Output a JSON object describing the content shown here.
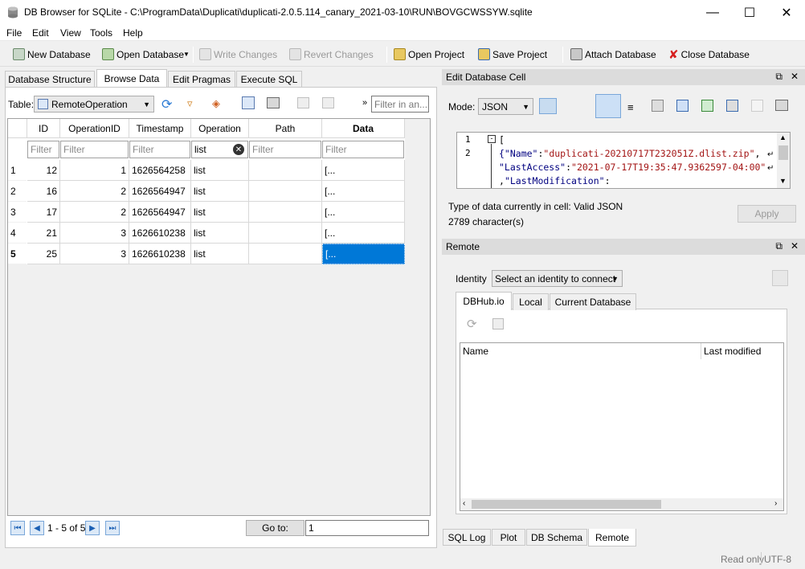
{
  "window": {
    "title": "DB Browser for SQLite - C:\\ProgramData\\Duplicati\\duplicati-2.0.5.114_canary_2021-03-10\\RUN\\BOVGCWSSYW.sqlite"
  },
  "menu": [
    "File",
    "Edit",
    "View",
    "Tools",
    "Help"
  ],
  "toolbar": {
    "new_db": "New Database",
    "open_db": "Open Database",
    "write": "Write Changes",
    "revert": "Revert Changes",
    "open_project": "Open Project",
    "save_project": "Save Project",
    "attach": "Attach Database",
    "close_db": "Close Database"
  },
  "tabs": [
    "Database Structure",
    "Browse Data",
    "Edit Pragmas",
    "Execute SQL"
  ],
  "browse": {
    "table_label": "Table:",
    "table_name": "RemoteOperation",
    "filter_any_placeholder": "Filter in an...",
    "columns": [
      "ID",
      "OperationID",
      "Timestamp",
      "Operation",
      "Path",
      "Data"
    ],
    "filter_placeholder": "Filter",
    "operation_filter": "list",
    "rows": [
      {
        "n": "1",
        "id": "12",
        "opid": "1",
        "ts": "1626564258",
        "op": "list",
        "path": "",
        "data": "[..."
      },
      {
        "n": "2",
        "id": "16",
        "opid": "2",
        "ts": "1626564947",
        "op": "list",
        "path": "",
        "data": "[..."
      },
      {
        "n": "3",
        "id": "17",
        "opid": "2",
        "ts": "1626564947",
        "op": "list",
        "path": "",
        "data": "[..."
      },
      {
        "n": "4",
        "id": "21",
        "opid": "3",
        "ts": "1626610238",
        "op": "list",
        "path": "",
        "data": "[..."
      },
      {
        "n": "5",
        "id": "25",
        "opid": "3",
        "ts": "1626610238",
        "op": "list",
        "path": "",
        "data": "[..."
      }
    ],
    "pager": "1 - 5 of 5",
    "goto_label": "Go to:",
    "goto_value": "1"
  },
  "edit_cell": {
    "title": "Edit Database Cell",
    "mode_label": "Mode:",
    "mode": "JSON",
    "line1": "[",
    "line2_key1": "{\"Name\"",
    "line2_val1": "\"duplicati-20210717T232051Z.dlist.zip\"",
    "line2_key2": "\"LastAccess\"",
    "line2_val2": "\"2021-07-17T19:35:47.9362597-04:00\"",
    "line2_key3": "\"LastModification\"",
    "type_info": "Type of data currently in cell: Valid JSON",
    "chars": "2789 character(s)",
    "apply": "Apply"
  },
  "remote": {
    "title": "Remote",
    "identity_label": "Identity",
    "identity_value": "Select an identity to connect",
    "tabs": [
      "DBHub.io",
      "Local",
      "Current Database"
    ],
    "col_name": "Name",
    "col_modified": "Last modified"
  },
  "bottom_tabs": [
    "SQL Log",
    "Plot",
    "DB Schema",
    "Remote"
  ],
  "status": {
    "readonly": "Read only",
    "encoding": "UTF-8"
  },
  "colors": {
    "selection": "#0078d7",
    "accent": "#1a5fb4"
  }
}
